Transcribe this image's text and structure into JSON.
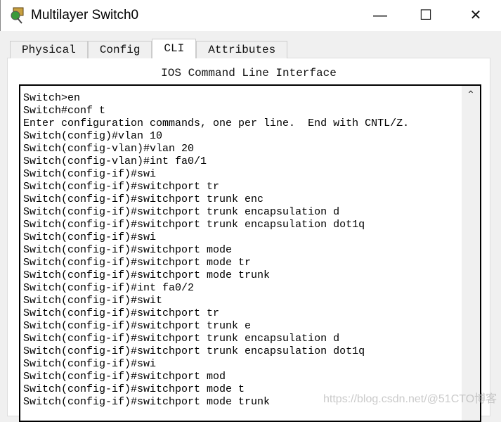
{
  "window": {
    "title": "Multilayer Switch0",
    "minimize": "—",
    "maximize": "☐",
    "close": "✕"
  },
  "tabs": [
    {
      "label": "Physical"
    },
    {
      "label": "Config"
    },
    {
      "label": "CLI",
      "active": true
    },
    {
      "label": "Attributes"
    }
  ],
  "panel": {
    "heading": "IOS Command Line Interface"
  },
  "terminal": {
    "lines": [
      "Switch>en",
      "Switch#conf t",
      "Enter configuration commands, one per line.  End with CNTL/Z.",
      "Switch(config)#vlan 10",
      "Switch(config-vlan)#vlan 20",
      "Switch(config-vlan)#int fa0/1",
      "Switch(config-if)#swi",
      "Switch(config-if)#switchport tr",
      "Switch(config-if)#switchport trunk enc",
      "Switch(config-if)#switchport trunk encapsulation d",
      "Switch(config-if)#switchport trunk encapsulation dot1q",
      "Switch(config-if)#swi",
      "Switch(config-if)#switchport mode",
      "Switch(config-if)#switchport mode tr",
      "Switch(config-if)#switchport mode trunk",
      "Switch(config-if)#int fa0/2",
      "Switch(config-if)#swit",
      "Switch(config-if)#switchport tr",
      "Switch(config-if)#switchport trunk e",
      "Switch(config-if)#switchport trunk encapsulation d",
      "Switch(config-if)#switchport trunk encapsulation dot1q",
      "Switch(config-if)#swi",
      "Switch(config-if)#switchport mod",
      "Switch(config-if)#switchport mode t",
      "Switch(config-if)#switchport mode trunk"
    ],
    "scroll_up_icon": "chevron-up-icon"
  },
  "watermark": "https://blog.csdn.net/@51CTO博客"
}
